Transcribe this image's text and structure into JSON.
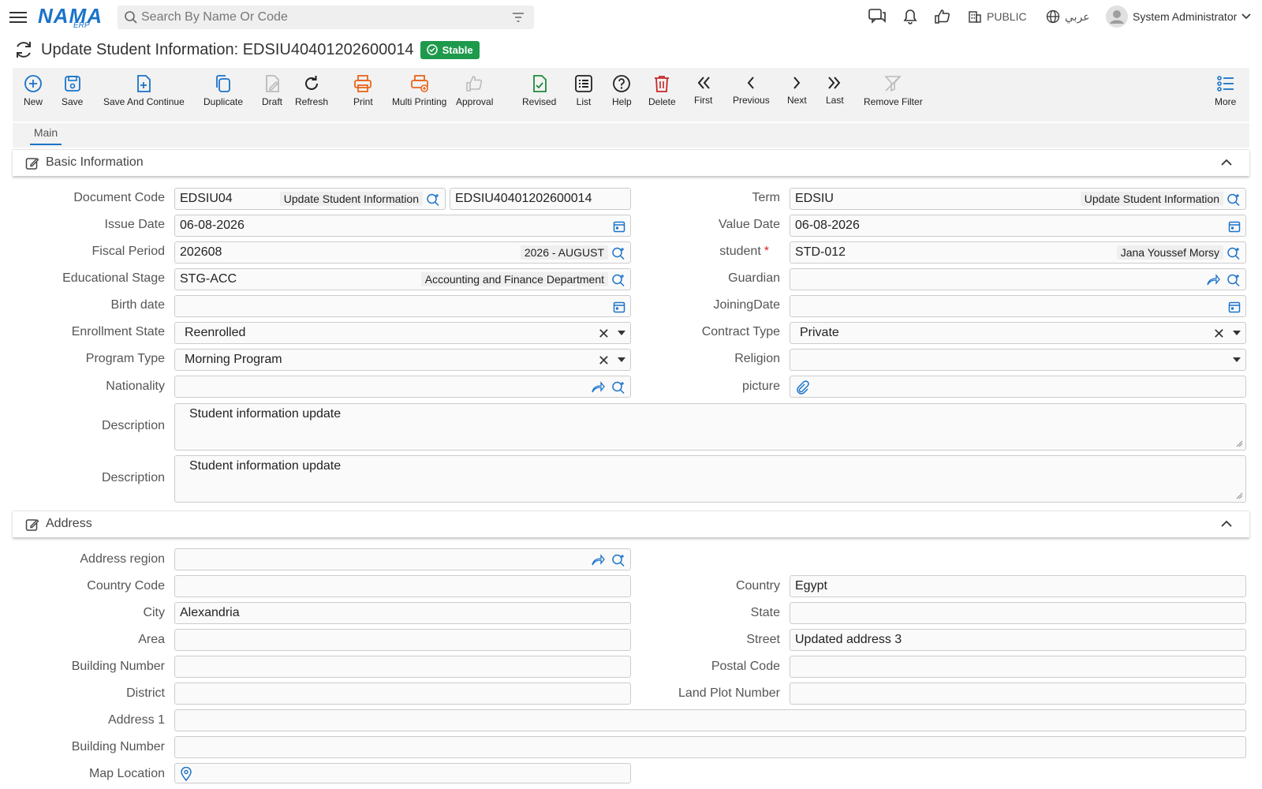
{
  "topbar": {
    "search_placeholder": "Search By Name Or Code",
    "logo_text": "NAMA",
    "logo_sub": "ERP",
    "branch": "PUBLIC",
    "language": "عربي",
    "user": "System Administrator"
  },
  "page": {
    "title": "Update Student Information: EDSIU40401202600014",
    "status": "Stable"
  },
  "toolbar": {
    "new": "New",
    "save": "Save",
    "save_continue": "Save And Continue",
    "duplicate": "Duplicate",
    "draft": "Draft",
    "refresh": "Refresh",
    "print": "Print",
    "multi_printing": "Multi Printing",
    "approval": "Approval",
    "revised": "Revised",
    "list": "List",
    "help": "Help",
    "delete": "Delete",
    "first": "First",
    "previous": "Previous",
    "next": "Next",
    "last": "Last",
    "remove_filter": "Remove Filter",
    "more": "More"
  },
  "tabs": {
    "main": "Main"
  },
  "basic": {
    "header": "Basic Information",
    "document_code": {
      "label": "Document Code",
      "code": "EDSIU04",
      "name": "Update Student Information",
      "number": "EDSIU40401202600014"
    },
    "term": {
      "label": "Term",
      "code": "EDSIU",
      "name": "Update Student Information"
    },
    "issue_date": {
      "label": "Issue Date",
      "value": "06-08-2026"
    },
    "value_date": {
      "label": "Value Date",
      "value": "06-08-2026"
    },
    "fiscal_period": {
      "label": "Fiscal Period",
      "code": "202608",
      "name": "2026 - AUGUST"
    },
    "student": {
      "label": "student",
      "code": "STD-012",
      "name": "Jana Youssef Morsy"
    },
    "educational_stage": {
      "label": "Educational Stage",
      "code": "STG-ACC",
      "name": "Accounting and Finance Department"
    },
    "guardian": {
      "label": "Guardian",
      "value": ""
    },
    "birth_date": {
      "label": "Birth date",
      "value": ""
    },
    "joining_date": {
      "label": "JoiningDate",
      "value": ""
    },
    "enrollment_state": {
      "label": "Enrollment State",
      "value": "Reenrolled"
    },
    "contract_type": {
      "label": "Contract Type",
      "value": "Private"
    },
    "program_type": {
      "label": "Program Type",
      "value": "Morning Program"
    },
    "religion": {
      "label": "Religion",
      "value": ""
    },
    "nationality": {
      "label": "Nationality",
      "value": ""
    },
    "picture": {
      "label": "picture",
      "value": ""
    },
    "description1": {
      "label": "Description",
      "value": "Student information update"
    },
    "description2": {
      "label": "Description",
      "value": "Student information update"
    }
  },
  "address": {
    "header": "Address",
    "address_region": {
      "label": "Address region",
      "value": ""
    },
    "country_code": {
      "label": "Country Code",
      "value": ""
    },
    "country": {
      "label": "Country",
      "value": "Egypt"
    },
    "city": {
      "label": "City",
      "value": "Alexandria"
    },
    "state": {
      "label": "State",
      "value": ""
    },
    "area": {
      "label": "Area",
      "value": ""
    },
    "street": {
      "label": "Street",
      "value": "Updated address 3"
    },
    "building_number": {
      "label": "Building Number",
      "value": ""
    },
    "postal_code": {
      "label": "Postal Code",
      "value": ""
    },
    "district": {
      "label": "District",
      "value": ""
    },
    "land_plot_number": {
      "label": "Land Plot Number",
      "value": ""
    },
    "address1": {
      "label": "Address 1",
      "value": ""
    },
    "building_number2": {
      "label": "Building Number",
      "value": ""
    },
    "map_location": {
      "label": "Map Location",
      "value": ""
    }
  },
  "colors": {
    "accent": "#1a73c9",
    "stable": "#1e9a4c",
    "print": "#e8641b",
    "delete": "#c62828",
    "revised": "#1e8a3c"
  }
}
